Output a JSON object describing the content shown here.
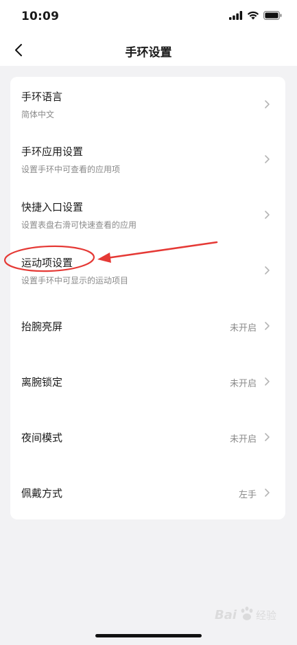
{
  "status_bar": {
    "time": "10:09",
    "icons": [
      "signal-icon",
      "wifi-icon",
      "battery-icon"
    ]
  },
  "nav": {
    "back_icon": "chevron-left-icon",
    "title": "手环设置"
  },
  "settings": [
    {
      "title": "手环语言",
      "subtitle": "简体中文",
      "value": ""
    },
    {
      "title": "手环应用设置",
      "subtitle": "设置手环中可查看的应用项",
      "value": ""
    },
    {
      "title": "快捷入口设置",
      "subtitle": "设置表盘右滑可快速查看的应用",
      "value": ""
    },
    {
      "title": "运动项设置",
      "subtitle": "设置手环中可显示的运动项目",
      "value": ""
    },
    {
      "title": "抬腕亮屏",
      "subtitle": "",
      "value": "未开启"
    },
    {
      "title": "离腕锁定",
      "subtitle": "",
      "value": "未开启"
    },
    {
      "title": "夜间模式",
      "subtitle": "",
      "value": "未开启"
    },
    {
      "title": "佩戴方式",
      "subtitle": "",
      "value": "左手"
    }
  ],
  "watermark": {
    "text": "Bai 经验"
  },
  "colors": {
    "annotation": "#e53935",
    "background": "#f2f2f4",
    "card": "#ffffff",
    "secondary_text": "#8a8a8a"
  }
}
